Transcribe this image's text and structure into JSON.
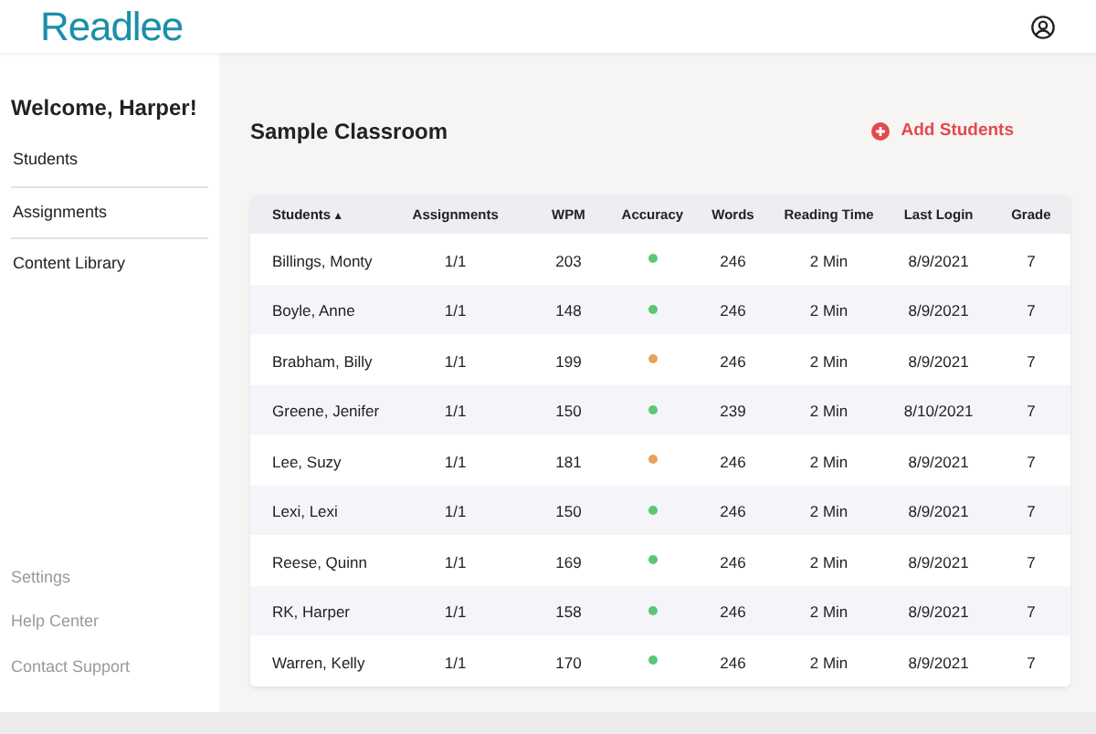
{
  "header": {
    "logo": "Readlee"
  },
  "sidebar": {
    "welcome": "Welcome, Harper!",
    "items": [
      "Students",
      "Assignments",
      "Content Library"
    ],
    "footer_items": [
      "Settings",
      "Help Center",
      "Contact Support"
    ]
  },
  "main": {
    "title": "Sample Classroom",
    "add_button": "Add Students"
  },
  "table": {
    "columns": [
      {
        "label": "Students",
        "sort": "▲"
      },
      {
        "label": "Assignments"
      },
      {
        "label": "WPM"
      },
      {
        "label": "Accuracy"
      },
      {
        "label": "Words"
      },
      {
        "label": "Reading Time"
      },
      {
        "label": "Last Login"
      },
      {
        "label": "Grade"
      }
    ],
    "rows": [
      {
        "student": "Billings, Monty",
        "assignments": "1/1",
        "wpm": "203",
        "color": "#5cc773",
        "words": "246",
        "reading_time": "2 Min",
        "last_login": "8/9/2021",
        "grade": "7"
      },
      {
        "student": "Boyle, Anne",
        "assignments": "1/1",
        "wpm": "148",
        "color": "#5cc773",
        "words": "246",
        "reading_time": "2 Min",
        "last_login": "8/9/2021",
        "grade": "7"
      },
      {
        "student": "Brabham, Billy",
        "assignments": "1/1",
        "wpm": "199",
        "color": "#e8a25c",
        "words": "246",
        "reading_time": "2 Min",
        "last_login": "8/9/2021",
        "grade": "7"
      },
      {
        "student": "Greene, Jenifer",
        "assignments": "1/1",
        "wpm": "150",
        "color": "#5cc773",
        "words": "239",
        "reading_time": "2 Min",
        "last_login": "8/10/2021",
        "grade": "7"
      },
      {
        "student": "Lee, Suzy",
        "assignments": "1/1",
        "wpm": "181",
        "color": "#e8a25c",
        "words": "246",
        "reading_time": "2 Min",
        "last_login": "8/9/2021",
        "grade": "7"
      },
      {
        "student": "Lexi, Lexi",
        "assignments": "1/1",
        "wpm": "150",
        "color": "#5cc773",
        "words": "246",
        "reading_time": "2 Min",
        "last_login": "8/9/2021",
        "grade": "7"
      },
      {
        "student": "Reese, Quinn",
        "assignments": "1/1",
        "wpm": "169",
        "color": "#5cc773",
        "words": "246",
        "reading_time": "2 Min",
        "last_login": "8/9/2021",
        "grade": "7"
      },
      {
        "student": "RK, Harper",
        "assignments": "1/1",
        "wpm": "158",
        "color": "#5cc773",
        "words": "246",
        "reading_time": "2 Min",
        "last_login": "8/9/2021",
        "grade": "7"
      },
      {
        "student": "Warren, Kelly",
        "assignments": "1/1",
        "wpm": "170",
        "color": "#5cc773",
        "words": "246",
        "reading_time": "2 Min",
        "last_login": "8/9/2021",
        "grade": "7"
      }
    ]
  }
}
